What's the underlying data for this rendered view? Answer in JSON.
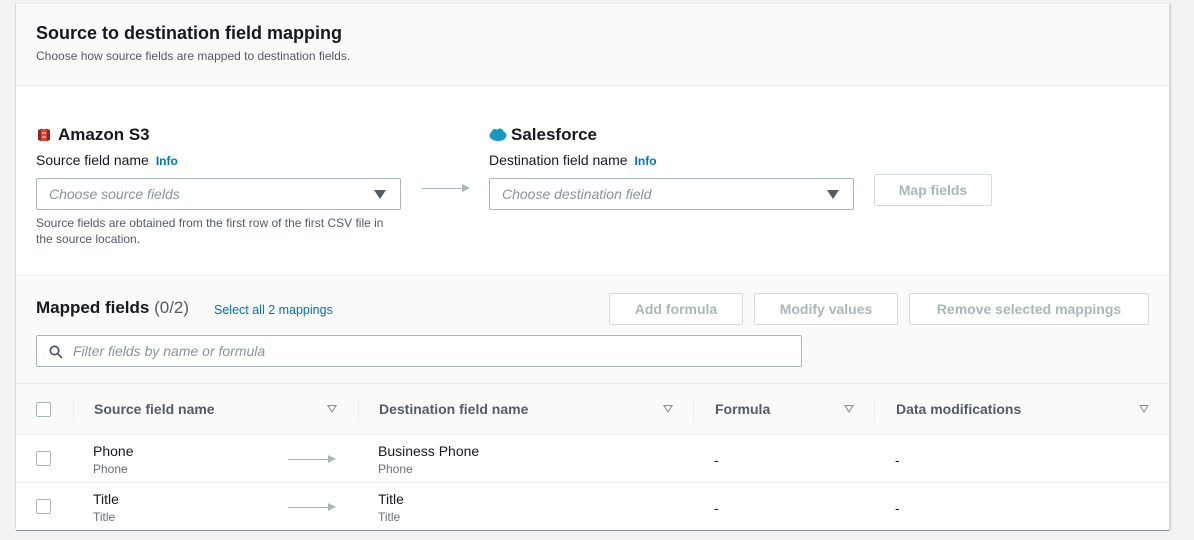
{
  "header": {
    "title": "Source to destination field mapping",
    "description": "Choose how source fields are mapped to destination fields."
  },
  "source": {
    "service_name": "Amazon S3",
    "service_icon": "amazon-s3-icon",
    "field_label": "Source field name",
    "info_label": "Info",
    "select_placeholder": "Choose source fields",
    "hint": "Source fields are obtained from the first row of the first CSV file in the source location."
  },
  "destination": {
    "service_name": "Salesforce",
    "service_icon": "salesforce-icon",
    "field_label": "Destination field name",
    "info_label": "Info",
    "select_placeholder": "Choose destination field"
  },
  "map_fields_button": "Map fields",
  "mapped": {
    "title": "Mapped fields",
    "count": "(0/2)",
    "select_all_link": "Select all 2 mappings",
    "buttons": {
      "add_formula": "Add formula",
      "modify_values": "Modify values",
      "remove_selected": "Remove selected mappings"
    },
    "filter_placeholder": "Filter fields by name or formula"
  },
  "table": {
    "columns": [
      "Source field name",
      "Destination field name",
      "Formula",
      "Data modifications"
    ],
    "rows": [
      {
        "source": "Phone",
        "source_sub": "Phone",
        "destination": "Business Phone",
        "destination_sub": "Phone",
        "formula": "-",
        "modifications": "-"
      },
      {
        "source": "Title",
        "source_sub": "Title",
        "destination": "Title",
        "destination_sub": "Title",
        "formula": "-",
        "modifications": "-"
      }
    ]
  },
  "colors": {
    "link": "#0073bb",
    "s3_icon": "#c7392c",
    "salesforce_icon": "#1798c1"
  }
}
